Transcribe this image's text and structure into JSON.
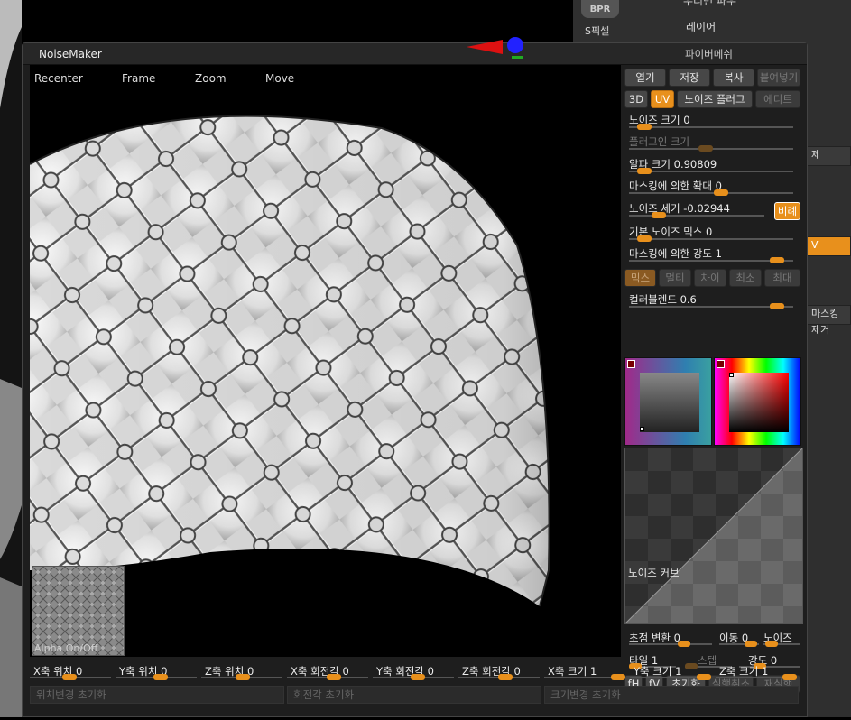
{
  "background": {
    "bpr_label": "BPR",
    "top_cut_text": "우리면 파우",
    "layer_label": "레이어",
    "s_pixel_label": "S픽셀",
    "side_btn_1": "제",
    "side_btn_2": "V",
    "side_btn_3": "마스킹 제거"
  },
  "window": {
    "title": "NoiseMaker",
    "fibermesh_label": "파이버메쉬"
  },
  "viewport": {
    "menu": [
      "Recenter",
      "Frame",
      "Zoom",
      "Move"
    ],
    "alpha_label": "Alpha On/Off"
  },
  "panel": {
    "buttons_row1": [
      "열기",
      "저장",
      "복사",
      "붙여넣기"
    ],
    "buttons_row2": [
      "3D",
      "UV",
      "노이즈 플러그",
      "에디트"
    ],
    "noise_scale": {
      "label": "노이즈 크기",
      "value": "0",
      "pos": 0.05
    },
    "plugin_scale": {
      "label": "플러그인 크기",
      "value": "",
      "pos": 0.45
    },
    "alpha_scale": {
      "label": "알파 크기",
      "value": "0.90809",
      "pos": 0.05
    },
    "mask_zoom": {
      "label": "마스킹에 의한 확대",
      "value": "0",
      "pos": 0.55
    },
    "noise_strength": {
      "label": "노이즈 세기",
      "value": "-0.02944",
      "pos": 0.18
    },
    "ratio_btn": "비례",
    "base_noise_mix": {
      "label": "기본 노이즈 믹스",
      "value": "0",
      "pos": 0.05
    },
    "mask_strength": {
      "label": "마스킹에 의한 강도",
      "value": "1",
      "pos": 0.92
    },
    "mix_modes": [
      "믹스",
      "멀티",
      "차이",
      "최소",
      "최대"
    ],
    "color_blend": {
      "label": "컬러블렌드",
      "value": "0.6",
      "pos": 0.92
    },
    "curve_label": "노이즈 커브",
    "focal_shift": {
      "label": "초점 변환",
      "value": "0"
    },
    "move": {
      "label": "이동",
      "value": "0"
    },
    "noise": {
      "label": "노이즈"
    },
    "tile": {
      "label": "타일",
      "value": "1"
    },
    "step": {
      "label": "스텝"
    },
    "intensity": {
      "label": "강도",
      "value": "0"
    },
    "buttons_row3": [
      "fH",
      "fV",
      "초기화",
      "실행취소",
      "재실행"
    ]
  },
  "bottom": {
    "sliders": [
      {
        "label": "X축 위치",
        "value": "0"
      },
      {
        "label": "Y축 위치",
        "value": "0"
      },
      {
        "label": "Z축 위치",
        "value": "0"
      },
      {
        "label": "X축 회전각",
        "value": "0"
      },
      {
        "label": "Y축 회전각",
        "value": "0"
      },
      {
        "label": "Z축 회전각",
        "value": "0"
      },
      {
        "label": "X축 크기",
        "value": "1"
      },
      {
        "label": "Y축 크기",
        "value": "1"
      },
      {
        "label": "Z축 크기",
        "value": "1"
      }
    ],
    "reset_buttons": [
      "위치변경 초기화",
      "회전각 초기화",
      "크기변경 초기화"
    ]
  },
  "colors": {
    "accent": "#e8901c",
    "panel": "#2f2f2f",
    "viewport": "#000000"
  }
}
